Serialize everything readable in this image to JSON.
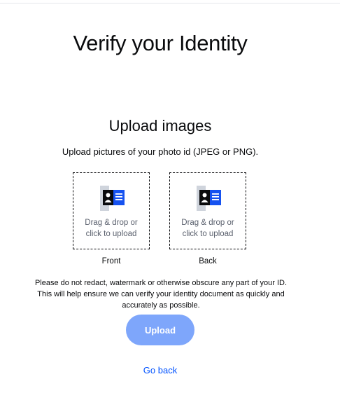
{
  "header": {
    "title": "Verify your Identity"
  },
  "upload": {
    "section_title": "Upload images",
    "instructions": "Upload pictures of your photo id (JPEG or PNG).",
    "front": {
      "line1": "Drag & drop or",
      "line2": "click to upload",
      "caption": "Front",
      "icon": "id-card-icon"
    },
    "back": {
      "line1": "Drag & drop or",
      "line2": "click to upload",
      "caption": "Back",
      "icon": "id-card-icon"
    },
    "notice": "Please do not redact, watermark or otherwise obscure any part of your ID. This will help ensure we can verify your identity document as quickly and accurately as possible.",
    "button_label": "Upload",
    "back_link": "Go back"
  },
  "colors": {
    "button_bg": "#7ea6fb",
    "link": "#0052ff",
    "icon_blue": "#1652f0",
    "muted_text": "#5b616e"
  }
}
